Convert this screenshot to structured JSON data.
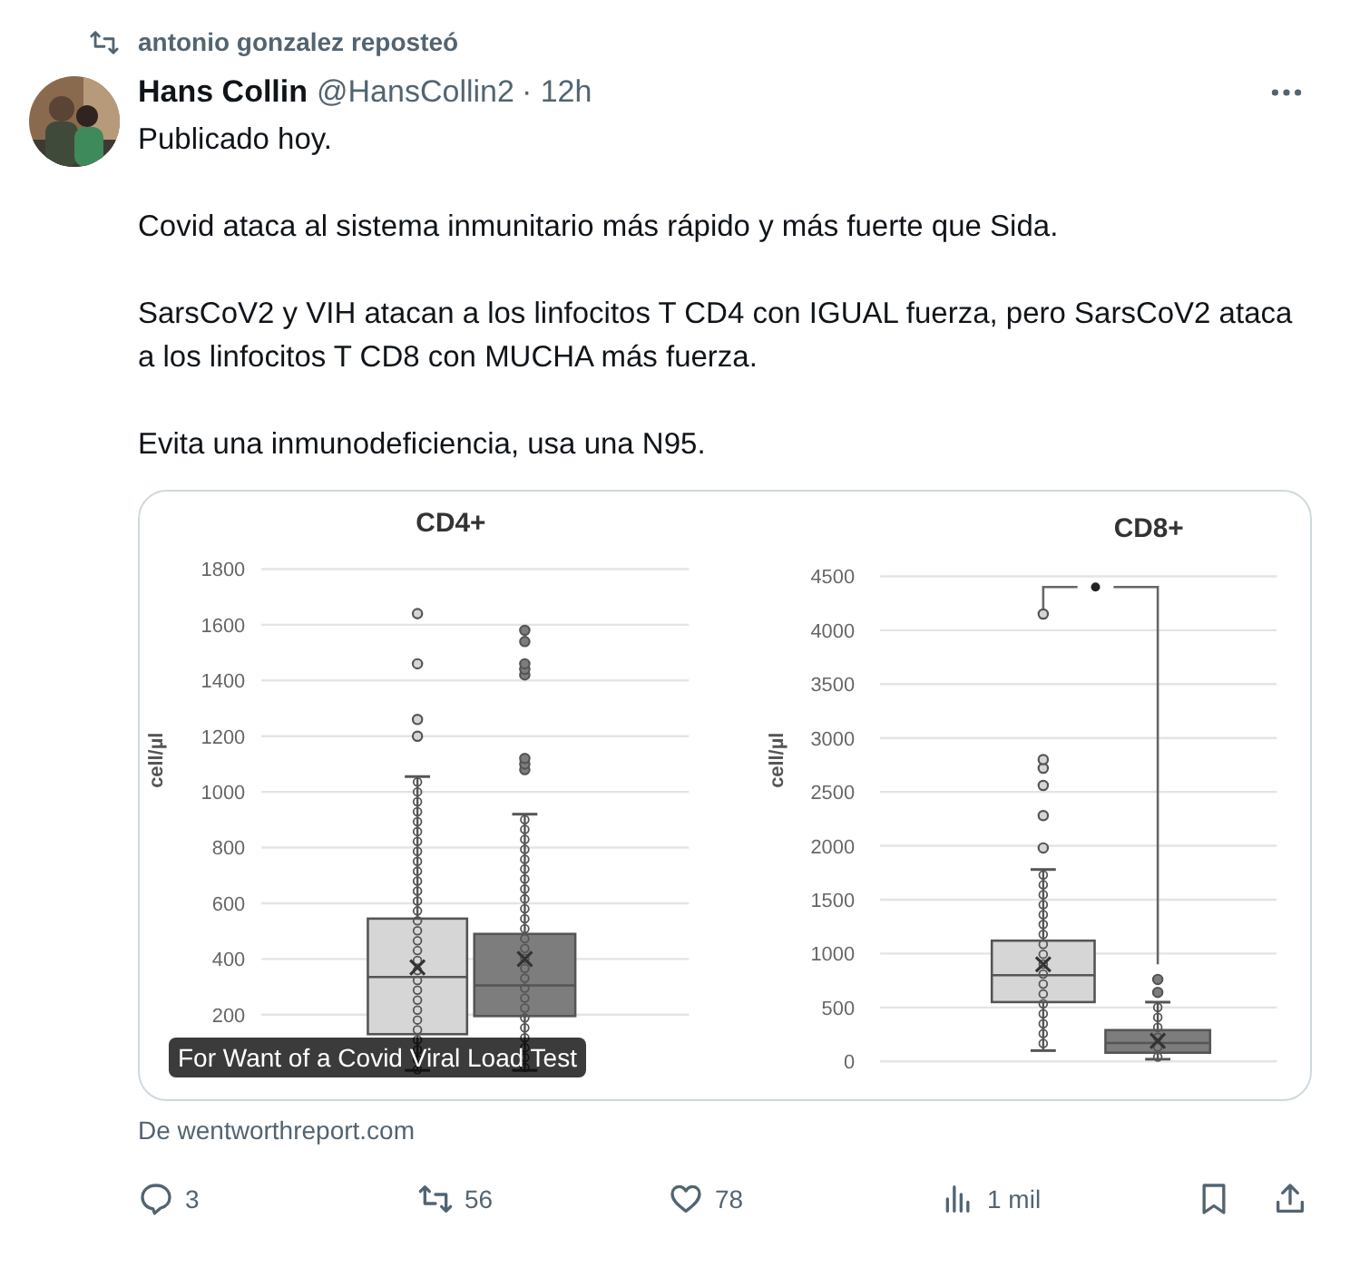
{
  "repost": {
    "text": "antonio gonzalez reposteó"
  },
  "author": {
    "name": "Hans Collin",
    "handle": "@HansCollin2",
    "time": "· 12h"
  },
  "paragraphs": [
    "Publicado hoy.",
    "Covid ataca al sistema inmunitario más rápido y más fuerte que Sida.",
    "SarsCoV2 y VIH atacan a los linfocitos T CD4 con IGUAL fuerza, pero SarsCoV2 ataca a los linfocitos T CD8 con MUCHA más fuerza.",
    "Evita una inmunodeficiencia, usa una N95."
  ],
  "media": {
    "charts": [
      {
        "title": "CD4+",
        "ylabel": "cell/µl",
        "yticks": [
          "1800",
          "1600",
          "1400",
          "1200",
          "1000",
          "800",
          "600",
          "400",
          "200"
        ]
      },
      {
        "title": "CD8+",
        "ylabel": "cell/µl",
        "yticks": [
          "4500",
          "4000",
          "3500",
          "3000",
          "2500",
          "2000",
          "1500",
          "1000",
          "500",
          "0"
        ]
      }
    ],
    "caption": "For Want of a Covid Viral Load Test"
  },
  "source": "De wentworthreport.com",
  "actions": [
    {
      "kind": "reply",
      "count": "3"
    },
    {
      "kind": "repost",
      "count": "56"
    },
    {
      "kind": "like",
      "count": "78"
    },
    {
      "kind": "views",
      "count": "1 mil"
    },
    {
      "kind": "bookmark"
    },
    {
      "kind": "share"
    }
  ]
}
